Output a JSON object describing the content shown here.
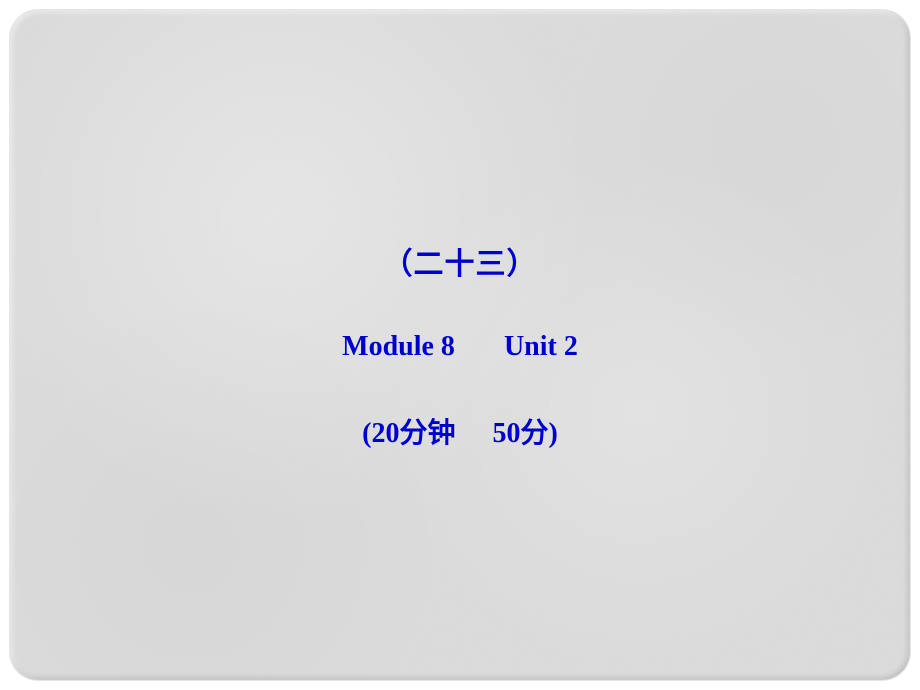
{
  "slide": {
    "lesson_number": "（二十三）",
    "module_label": "Module 8",
    "unit_label": "Unit 2",
    "duration_label": "(20分钟",
    "score_label": "50分)"
  }
}
